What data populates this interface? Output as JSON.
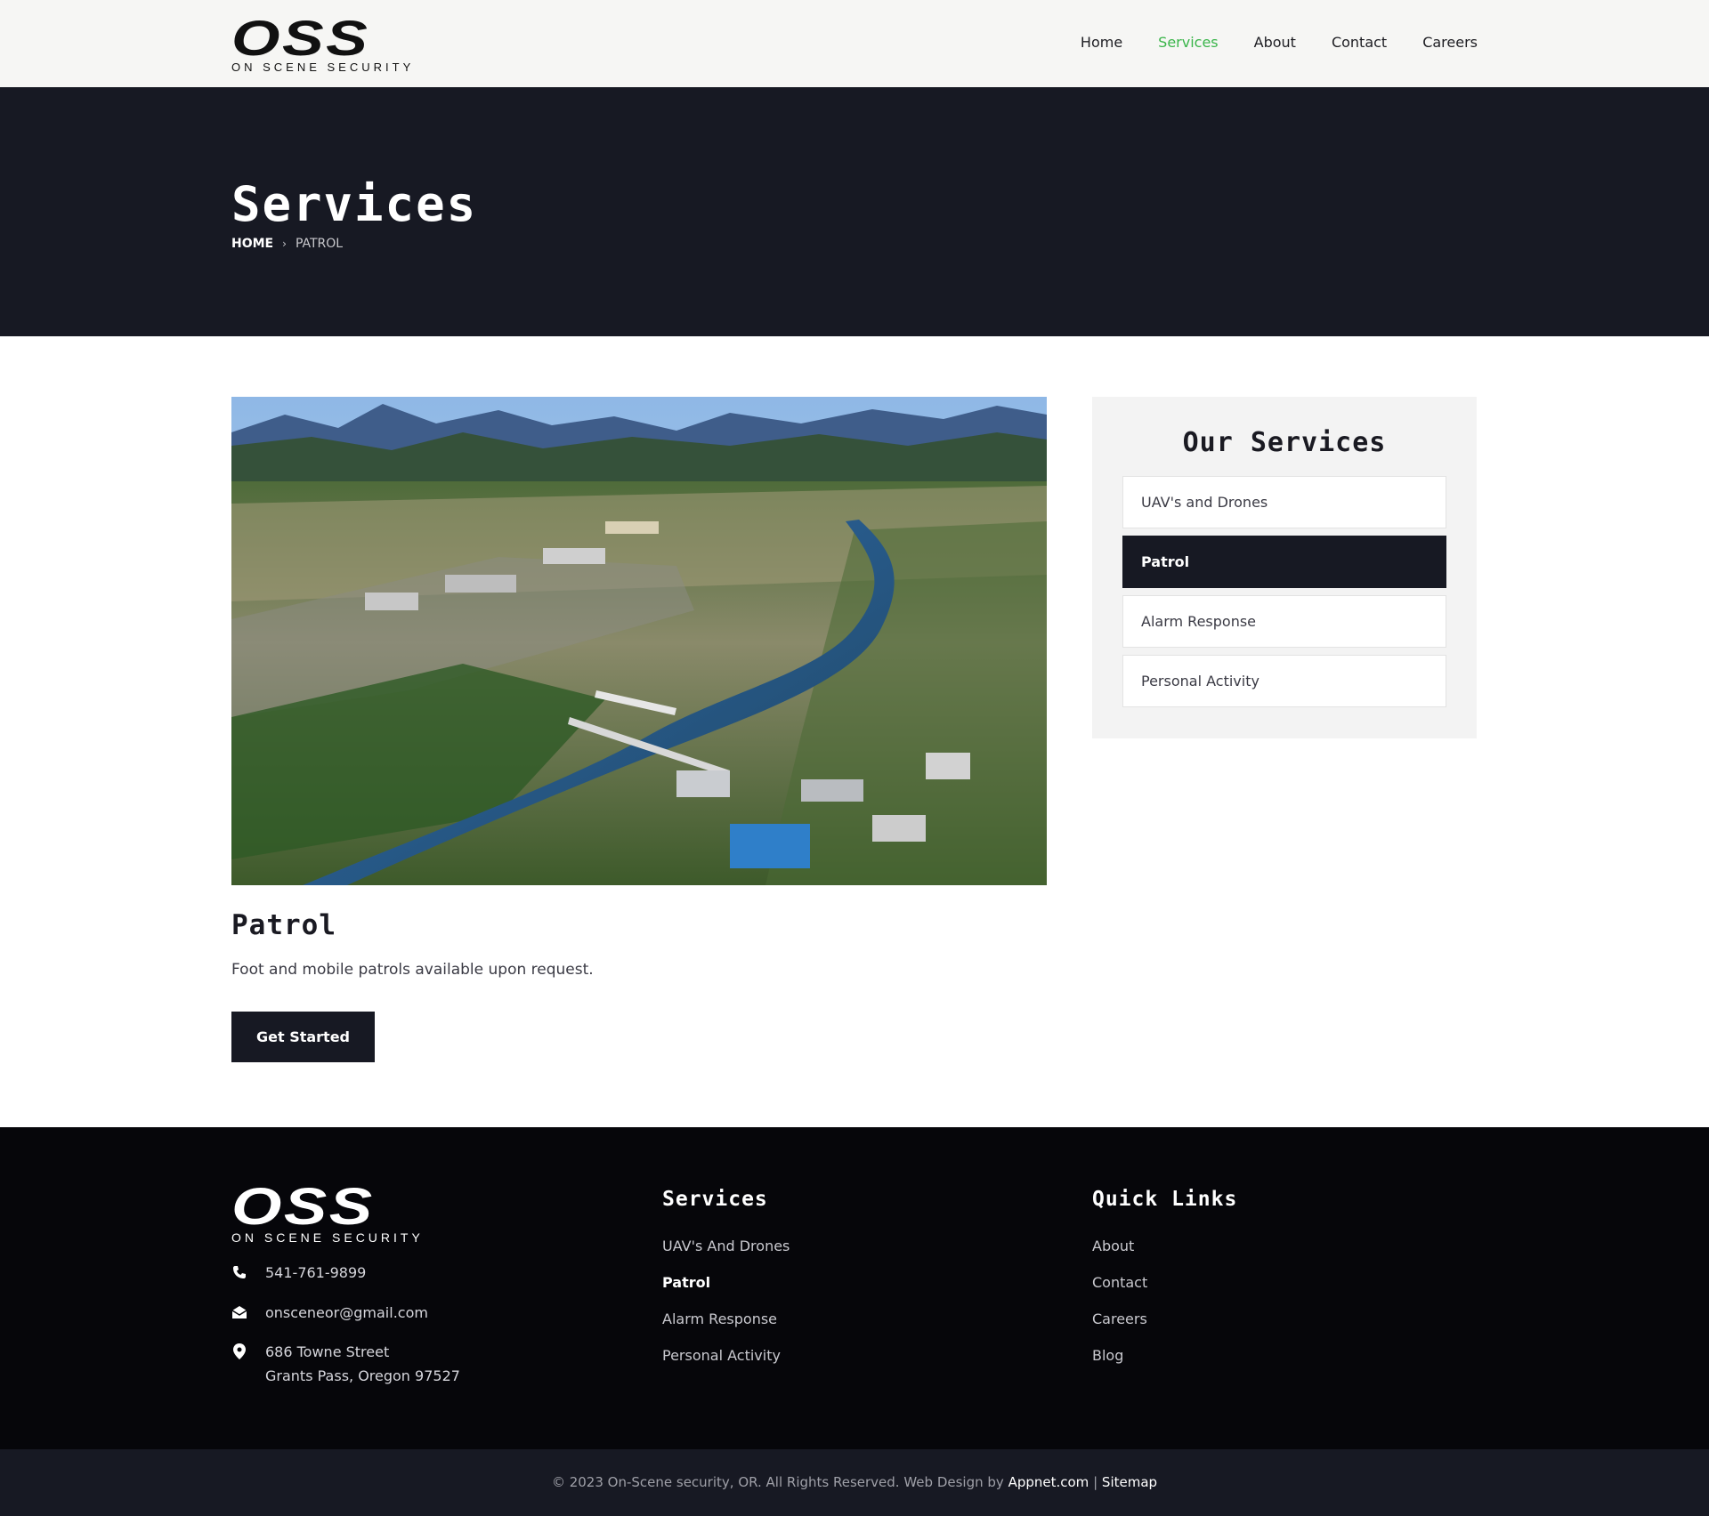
{
  "brand": {
    "logo_text": "OSS",
    "logo_subtitle": "ON SCENE SECURITY"
  },
  "nav": {
    "items": [
      {
        "label": "Home",
        "active": false
      },
      {
        "label": "Services",
        "active": true
      },
      {
        "label": "About",
        "active": false
      },
      {
        "label": "Contact",
        "active": false
      },
      {
        "label": "Careers",
        "active": false
      }
    ],
    "active_color": "#3ab54a"
  },
  "hero": {
    "title": "Services",
    "breadcrumb": {
      "home": "HOME",
      "separator": "›",
      "current": "PATROL"
    }
  },
  "main": {
    "image_icon": "aerial-city-river-photo",
    "service_title": "Patrol",
    "service_description": "Foot and mobile patrols available upon request.",
    "cta_label": "Get Started"
  },
  "sidebar": {
    "title": "Our Services",
    "items": [
      {
        "label": "UAV's and Drones",
        "active": false
      },
      {
        "label": "Patrol",
        "active": true
      },
      {
        "label": "Alarm Response",
        "active": false
      },
      {
        "label": "Personal Activity",
        "active": false
      }
    ]
  },
  "footer": {
    "phone": "541-761-9899",
    "email": "onsceneor@gmail.com",
    "address_line1": "686 Towne Street",
    "address_line2": "Grants Pass, Oregon 97527",
    "services_title": "Services",
    "services_links": [
      {
        "label": "UAV's And Drones",
        "current": false
      },
      {
        "label": "Patrol",
        "current": true
      },
      {
        "label": "Alarm Response",
        "current": false
      },
      {
        "label": "Personal Activity",
        "current": false
      }
    ],
    "quick_title": "Quick Links",
    "quick_links": [
      "About",
      "Contact",
      "Careers",
      "Blog"
    ],
    "copyright_text": "© 2023 On-Scene security, OR. All Rights Reserved. Web Design by",
    "designer_link": "Appnet.com",
    "divider": "|",
    "sitemap_link": "Sitemap"
  },
  "colors": {
    "dark_navy": "#171923",
    "footer_black": "#06060a",
    "accent_green": "#3ab54a"
  }
}
